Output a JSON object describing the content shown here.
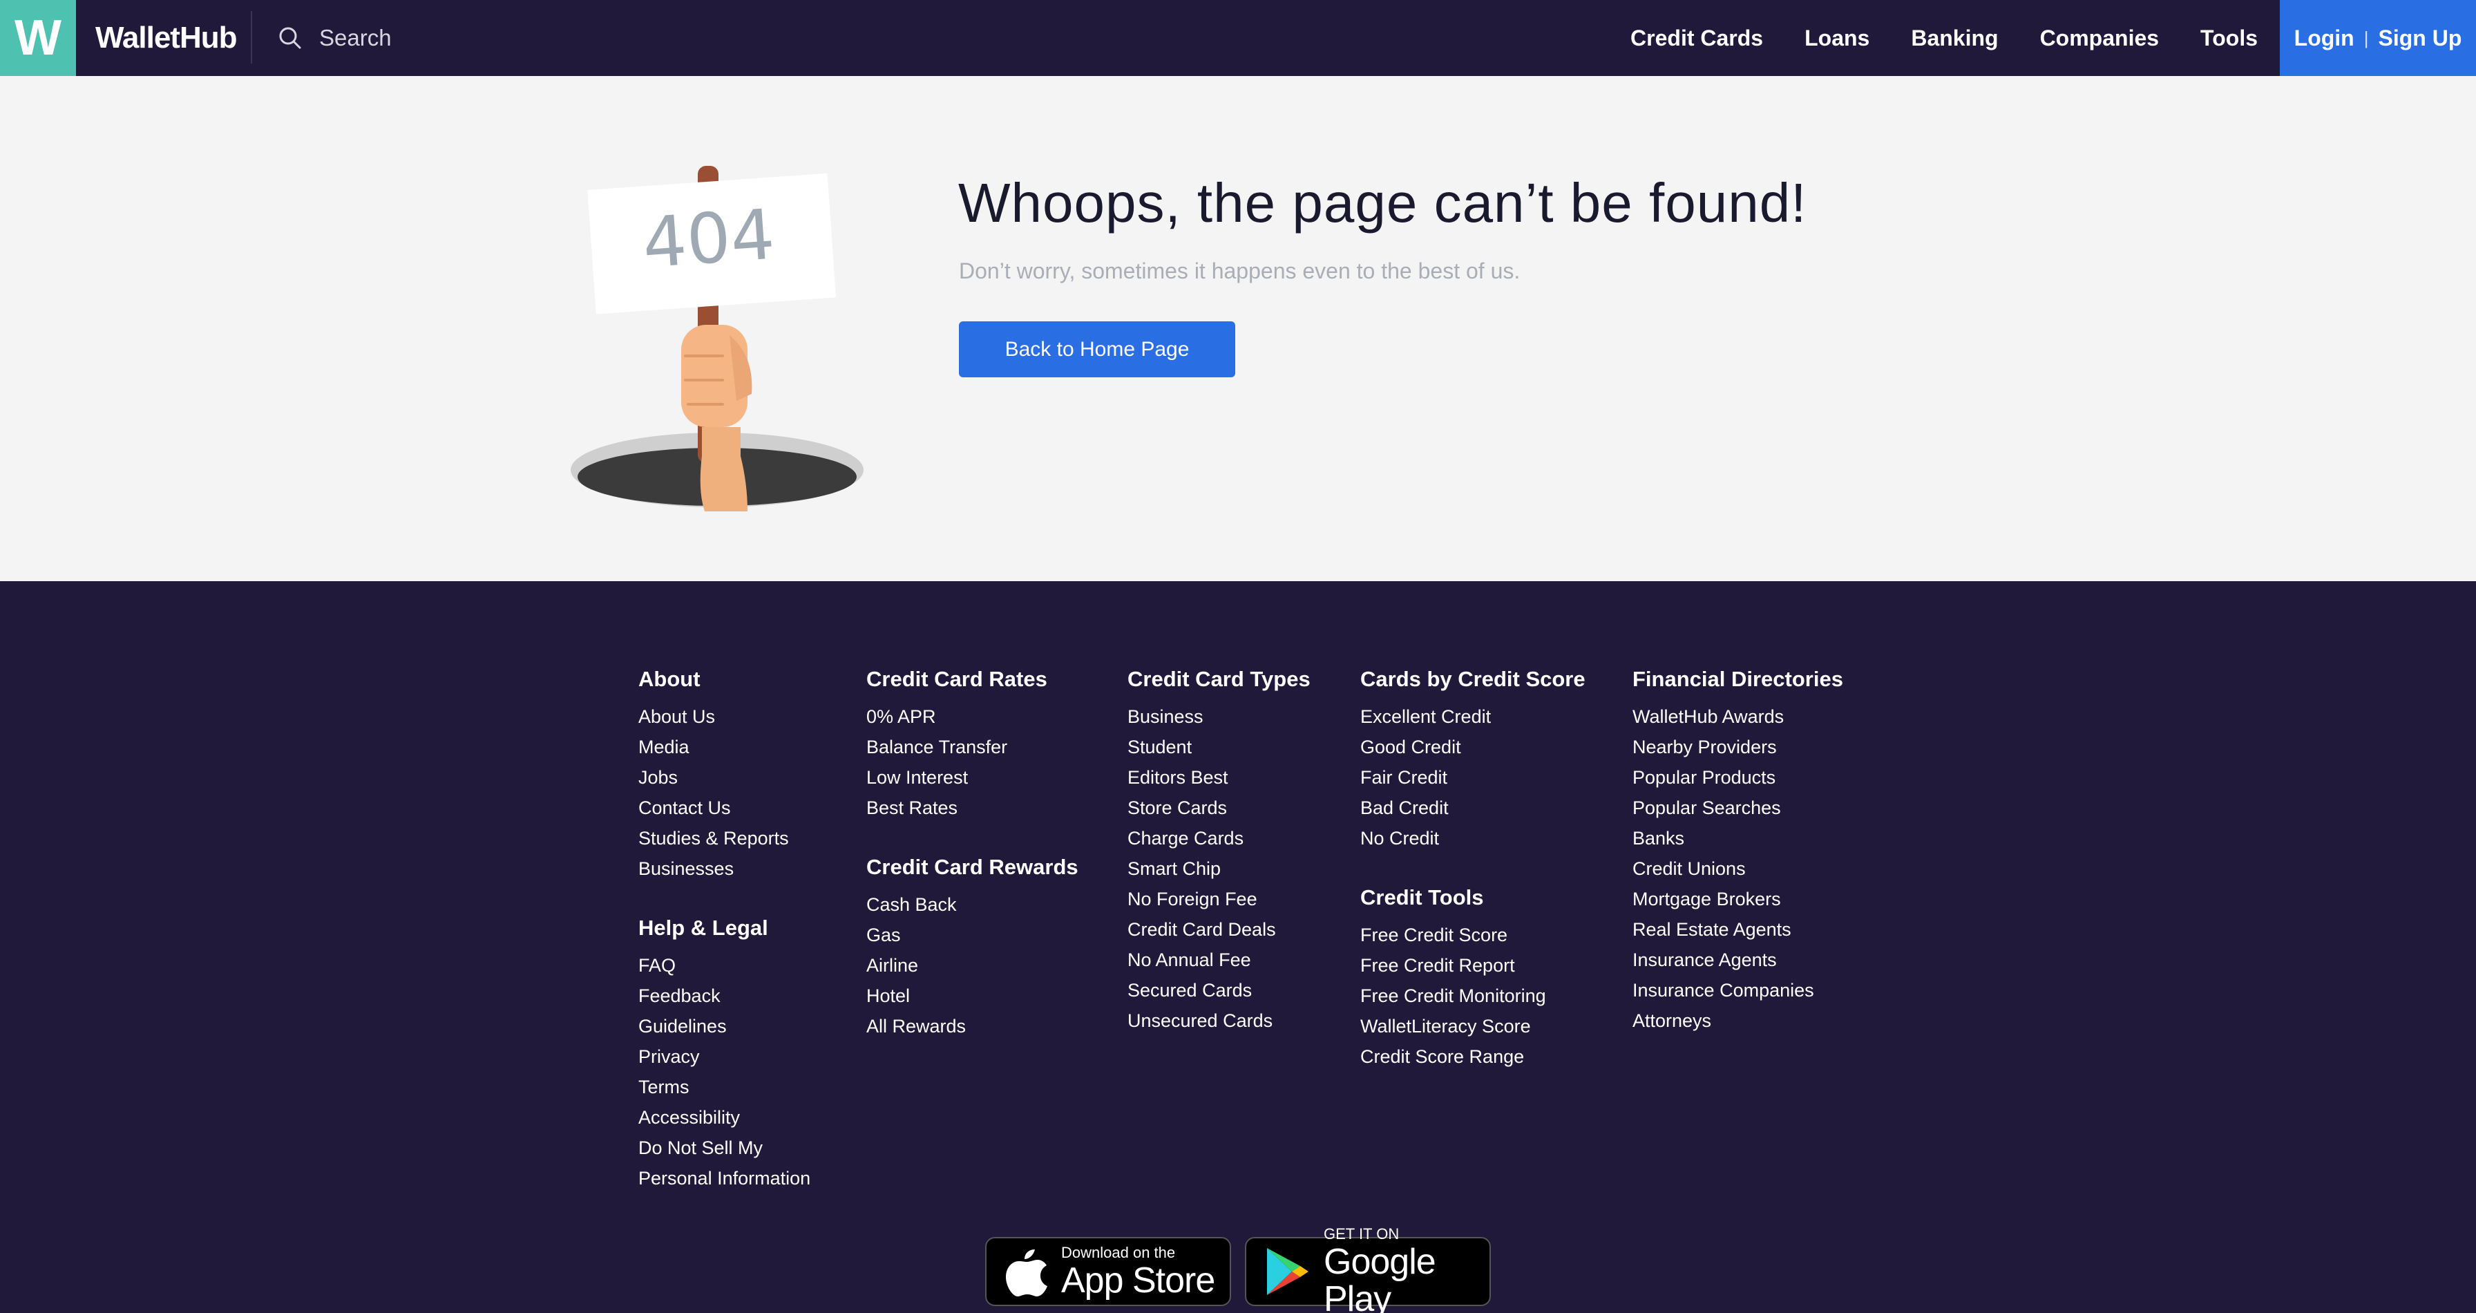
{
  "header": {
    "logo_letter": "W",
    "brand": "WalletHub",
    "search_placeholder": "Search",
    "nav": [
      "Credit Cards",
      "Loans",
      "Banking",
      "Companies",
      "Tools"
    ],
    "login": "Login",
    "separator": "|",
    "signup": "Sign Up"
  },
  "main": {
    "sign_text": "404",
    "title": "Whoops, the page can’t be found!",
    "subtitle": "Don’t worry, sometimes it happens even to the best of us.",
    "button": "Back to Home Page"
  },
  "footer": {
    "col1": {
      "heading": "About",
      "links": [
        "About Us",
        "Media",
        "Jobs",
        "Contact Us",
        "Studies & Reports",
        "Businesses"
      ],
      "heading2": "Help & Legal",
      "links2": [
        "FAQ",
        "Feedback",
        "Guidelines",
        "Privacy",
        "Terms",
        "Accessibility",
        "Do Not Sell My",
        "Personal Information"
      ]
    },
    "col2": {
      "heading": "Credit Card Rates",
      "links": [
        "0% APR",
        "Balance Transfer",
        "Low Interest",
        "Best Rates"
      ],
      "heading2": "Credit Card Rewards",
      "links2": [
        "Cash Back",
        "Gas",
        "Airline",
        "Hotel",
        "All Rewards"
      ]
    },
    "col3": {
      "heading": "Credit Card Types",
      "links": [
        "Business",
        "Student",
        "Editors Best",
        "Store Cards",
        "Charge Cards",
        "Smart Chip",
        "No Foreign Fee",
        "Credit Card Deals",
        "No Annual Fee",
        "Secured Cards",
        "Unsecured Cards"
      ]
    },
    "col4": {
      "heading": "Cards by Credit Score",
      "links": [
        "Excellent Credit",
        "Good Credit",
        "Fair Credit",
        "Bad Credit",
        "No Credit"
      ],
      "heading2": "Credit Tools",
      "links2": [
        "Free Credit Score",
        "Free Credit Report",
        "Free Credit Monitoring",
        "WalletLiteracy Score",
        "Credit Score Range"
      ]
    },
    "col5": {
      "heading": "Financial Directories",
      "links": [
        "WalletHub Awards",
        "Nearby Providers",
        "Popular Products",
        "Popular Searches",
        "Banks",
        "Credit Unions",
        "Mortgage Brokers",
        "Real Estate Agents",
        "Insurance Agents",
        "Insurance Companies",
        "Attorneys"
      ]
    },
    "app_store": {
      "small": "Download on the",
      "big": "App Store"
    },
    "google_play": {
      "small": "GET IT ON",
      "big": "Google Play"
    }
  },
  "colors": {
    "header_bg": "#211939",
    "logo_bg": "#4fc1b0",
    "accent_blue": "#2a6ee3",
    "page_bg": "#f4f4f4"
  }
}
